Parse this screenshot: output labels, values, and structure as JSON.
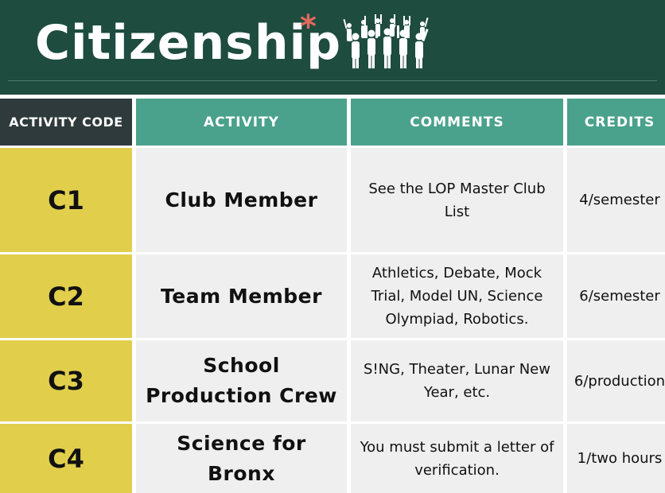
{
  "header": {
    "title": "Citizenship",
    "asterisk": "*",
    "icon": "crowd-cheering-icon"
  },
  "table": {
    "columns": [
      "ACTIVITY CODE",
      "ACTIVITY",
      "COMMENTS",
      "CREDITS"
    ],
    "rows": [
      {
        "code": "C1",
        "activity": "Club Member",
        "comments": "See the LOP Master Club List",
        "credits": "4/semester"
      },
      {
        "code": "C2",
        "activity": "Team Member",
        "comments": "Athletics, Debate, Mock Trial, Model UN, Science Olympiad, Robotics.",
        "credits": "6/semester"
      },
      {
        "code": "C3",
        "activity": "School Production Crew",
        "comments": "S!NG, Theater, Lunar New Year, etc.",
        "credits": "6/production"
      },
      {
        "code": "C4",
        "activity": "Science for Bronx",
        "comments": "You must submit a letter of verification.",
        "credits": "1/two hours"
      }
    ]
  },
  "colors": {
    "header_bg": "#1e4c3f",
    "header_cell": "#4aa18c",
    "code_header": "#2e3a3b",
    "code_cell": "#e1cf4c",
    "body_cell": "#efefef",
    "asterisk": "#e36a5c"
  }
}
